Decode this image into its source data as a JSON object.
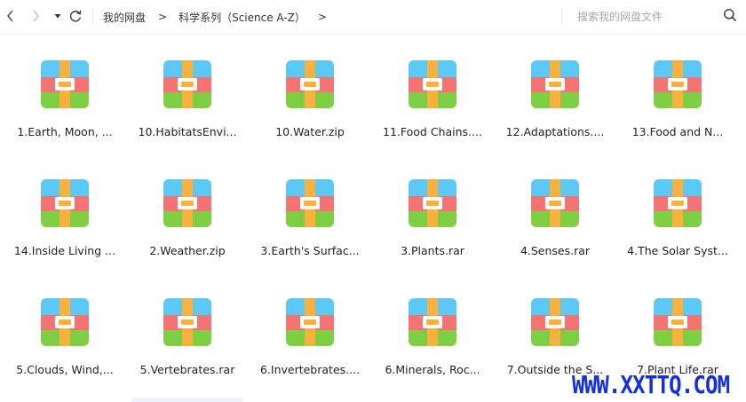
{
  "toolbar": {
    "back_icon": "chevron-left-icon",
    "forward_icon": "chevron-right-icon",
    "history_icon": "caret-down-icon",
    "refresh_icon": "refresh-icon"
  },
  "breadcrumb": {
    "items": [
      "我的网盘",
      "科学系列（Science A-Z）"
    ],
    "separator": ">"
  },
  "search": {
    "placeholder": "搜索我的网盘文件",
    "icon": "search-icon"
  },
  "files": [
    {
      "name": "1.Earth, Moon, ..."
    },
    {
      "name": "10.HabitatsEnvi..."
    },
    {
      "name": "10.Water.zip"
    },
    {
      "name": "11.Food Chains...."
    },
    {
      "name": "12.Adaptations...."
    },
    {
      "name": "13.Food and N..."
    },
    {
      "name": "14.Inside Living ..."
    },
    {
      "name": "2.Weather.zip"
    },
    {
      "name": "3.Earth's Surfac..."
    },
    {
      "name": "3.Plants.rar"
    },
    {
      "name": "4.Senses.rar"
    },
    {
      "name": "4.The Solar Syst..."
    },
    {
      "name": "5.Clouds, Wind,..."
    },
    {
      "name": "5.Vertebrates.rar"
    },
    {
      "name": "6.Invertebrates...."
    },
    {
      "name": "6.Minerals, Roc..."
    },
    {
      "name": "7.Outside the S..."
    },
    {
      "name": "7.Plant Life.rar"
    }
  ],
  "file_icon": "archive-file-icon",
  "colors": {
    "icon_top": "#5bc8f5",
    "icon_middle": "#f47474",
    "icon_bottom": "#7fcf44",
    "icon_strap": "#f9b03d",
    "watermark": "#1530e0"
  },
  "watermark": {
    "text": "WWW.XXTTQ.COM"
  }
}
